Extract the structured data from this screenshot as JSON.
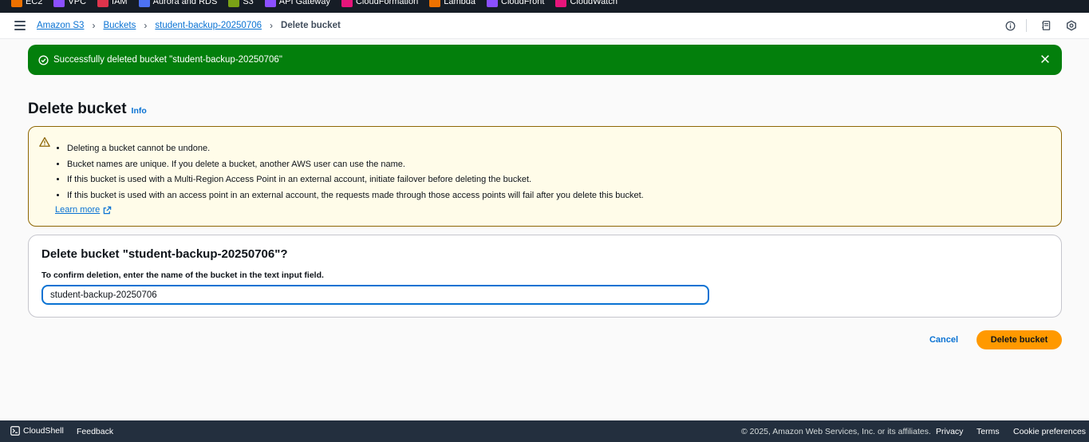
{
  "services_bar": [
    {
      "label": "EC2",
      "color": "#ed7100"
    },
    {
      "label": "VPC",
      "color": "#8c4fff"
    },
    {
      "label": "IAM",
      "color": "#dd344c"
    },
    {
      "label": "Aurora and RDS",
      "color": "#4d72f3"
    },
    {
      "label": "S3",
      "color": "#7aa116"
    },
    {
      "label": "API Gateway",
      "color": "#8c4fff"
    },
    {
      "label": "CloudFormation",
      "color": "#e7157b"
    },
    {
      "label": "Lambda",
      "color": "#ed7100"
    },
    {
      "label": "CloudFront",
      "color": "#8c4fff"
    },
    {
      "label": "CloudWatch",
      "color": "#e7157b"
    }
  ],
  "breadcrumb": {
    "items": [
      "Amazon S3",
      "Buckets",
      "student-backup-20250706"
    ],
    "current": "Delete bucket"
  },
  "flash": {
    "message": "Successfully deleted bucket \"student-backup-20250706\"",
    "color": "#037f0c"
  },
  "page": {
    "title": "Delete bucket",
    "info_link": "Info"
  },
  "warning": {
    "items": [
      "Deleting a bucket cannot be undone.",
      "Bucket names are unique. If you delete a bucket, another AWS user can use the name.",
      "If this bucket is used with a Multi-Region Access Point in an external account, initiate failover before deleting the bucket.",
      "If this bucket is used with an access point in an external account, the requests made through those access points will fail after you delete this bucket."
    ],
    "learn_more": "Learn more"
  },
  "confirm": {
    "heading": "Delete bucket \"student-backup-20250706\"?",
    "label": "To confirm deletion, enter the name of the bucket in the text input field.",
    "input_value": "student-backup-20250706"
  },
  "actions": {
    "cancel": "Cancel",
    "delete": "Delete bucket",
    "accent": "#ff9900"
  },
  "footer": {
    "cloudshell": "CloudShell",
    "feedback": "Feedback",
    "copyright": "© 2025, Amazon Web Services, Inc. or its affiliates.",
    "privacy": "Privacy",
    "terms": "Terms",
    "cookie": "Cookie preferences"
  }
}
